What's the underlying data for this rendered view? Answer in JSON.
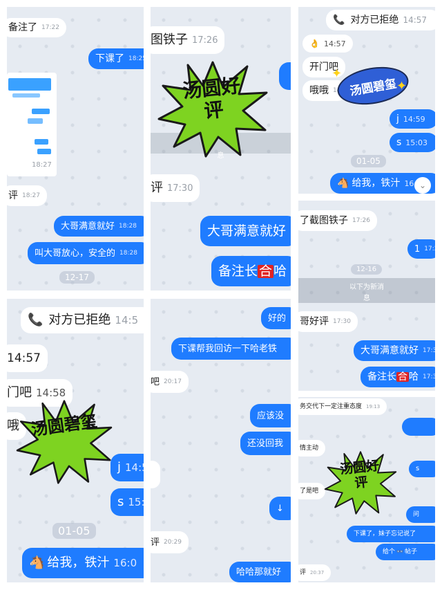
{
  "p1": {
    "m1": {
      "text": "备注了",
      "time": "17:22"
    },
    "m2": {
      "text": "下课了",
      "time": "18:25"
    },
    "thumb_time": "18:27",
    "m3": {
      "text": "评",
      "time": "18:27"
    },
    "m4": {
      "text": "大哥满意就好",
      "time": "18:28"
    },
    "m5": {
      "text": "叫大哥放心，安全的",
      "time": "18:28"
    },
    "date": "12-17"
  },
  "p2": {
    "m1": {
      "text": "图铁子",
      "time": "17:26"
    },
    "sticker": "汤圆好评",
    "sep": "息",
    "m2": {
      "text": "评",
      "time": "17:30"
    },
    "m3": {
      "text": "大哥满意就好"
    },
    "m4": {
      "pre": "备注长",
      "hl": "合",
      "post": "哈"
    }
  },
  "p3": {
    "m1": {
      "text": "对方已拒绝",
      "time": "14:57"
    },
    "m2": {
      "emoji": "👌",
      "time": "14:57"
    },
    "m3": {
      "text": "开门吧"
    },
    "m4": {
      "text": "哦哦",
      "time": "14"
    },
    "oval": "汤圆碧玺",
    "m5": {
      "text": "j",
      "time": "14:59"
    },
    "m6": {
      "text": "s",
      "time": "15:03"
    },
    "date": "01-05",
    "m7": {
      "emoji": "🐴",
      "text": "给我，铁汁",
      "time": "16:0"
    }
  },
  "p4": {
    "m1": {
      "text": "了截图铁子",
      "time": "17:26"
    },
    "m2": {
      "text": "1",
      "time": "17:26"
    },
    "date": "12-16",
    "sep1": "以下为新消",
    "sep2": "息",
    "m3": {
      "text": "哥好评",
      "time": "17:30"
    },
    "m4": {
      "text": "大哥满意就好",
      "time": "17:31"
    },
    "m5": {
      "pre": "备注长",
      "hl": "合",
      "post": "哈",
      "time": "17:31"
    }
  },
  "p5": {
    "m1": {
      "text": "对方已拒绝",
      "time": "14:5"
    },
    "m2": {
      "time": "14:57"
    },
    "m3": {
      "text": "门吧",
      "time": "14:58"
    },
    "m4": {
      "text": "哦"
    },
    "sticker": "汤圆碧玺",
    "m5": {
      "text": "j",
      "time": "14:5"
    },
    "m6": {
      "text": "s",
      "time": "15:0"
    },
    "date": "01-05",
    "m7": {
      "emoji": "🐴",
      "text": "给我，铁汁",
      "time": "16:0"
    }
  },
  "p6": {
    "m1": {
      "text": "好的"
    },
    "m2": {
      "text": "下课帮我回访一下哈老铁"
    },
    "m3": {
      "text": "吧",
      "time": "20:17"
    },
    "m4": {
      "text": "应该没"
    },
    "m5": {
      "text": "还没回我"
    },
    "m6": {
      "text": "↓"
    },
    "m7": {
      "text": "评",
      "time": "20:29"
    },
    "m8": {
      "text": "哈哈那就好"
    }
  },
  "p7": {
    "m1": {
      "text": "务交代下一定注重态度",
      "time": "19:13"
    },
    "m2": {
      "text": "情主动"
    },
    "m3": {
      "text": "s"
    },
    "m4": {
      "text": "了是吧"
    },
    "sticker": "汤圆好评",
    "m5": {
      "text": "问"
    },
    "m6": {
      "text": "下课了，妹子忘记说了"
    },
    "m7": {
      "text": "给个",
      "emoji": "👓",
      "post": "帖子"
    },
    "m8": {
      "text": "评",
      "time": "20:37"
    }
  },
  "colors": {
    "blue": "#1f7cff",
    "bg": "#e6ebf2",
    "star": "#7ed321"
  }
}
